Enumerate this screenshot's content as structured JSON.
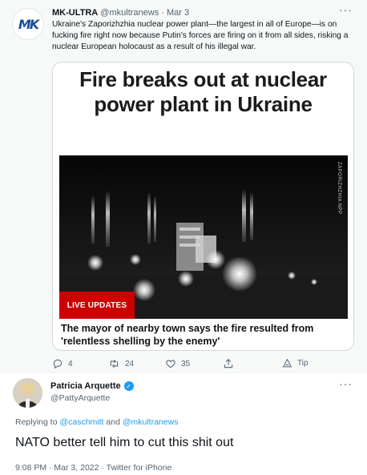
{
  "quoted": {
    "logo_text": "MK",
    "name": "MK-ULTRA",
    "handle": "@mkultranews",
    "separator": "·",
    "date": "Mar 3",
    "more": "···",
    "text": "Ukraine's Zaporizhzhia nuclear power plant—the largest in all of Europe—is on fucking fire right now because Putin's forces are firing on it from all sides, risking a nuclear European holocaust as a result of his illegal war.",
    "card": {
      "headline": "Fire breaks out at nuclear power plant in Ukraine",
      "badge": "LIVE UPDATES",
      "watermark": "ZAPORIZHZHIA NPP",
      "caption": "The mayor of nearby town says the fire resulted from 'relentless shelling by the enemy'"
    },
    "actions": {
      "replies": "4",
      "retweets": "24",
      "likes": "35",
      "tip": "Tip"
    }
  },
  "reply": {
    "name": "Patricia Arquette",
    "handle": "@PattyArquette",
    "more": "···",
    "replying_prefix": "Replying to",
    "mention1": "@caschmitt",
    "and": "and",
    "mention2": "@mkultranews",
    "text": "NATO better tell him to cut this shit out",
    "meta": "9:08 PM · Mar 3, 2022 · Twitter for iPhone"
  },
  "colors": {
    "accent": "#1d9bf0",
    "live_red": "#cc0000",
    "secondary_text": "#536471"
  }
}
